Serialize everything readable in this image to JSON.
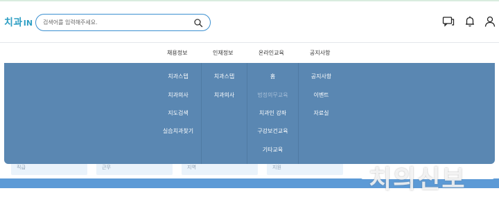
{
  "logo": {
    "korean": "치과",
    "in_prefix": "I",
    "in_suffix": "N"
  },
  "search": {
    "placeholder": "검색어를 입력해주세요."
  },
  "header_icons": [
    "chat-icon",
    "bell-icon",
    "user-icon"
  ],
  "nav": {
    "items": [
      "채용정보",
      "인재정보",
      "온라인교육",
      "공지사항"
    ]
  },
  "mega_menu": {
    "columns": [
      {
        "links": [
          "치과스텝",
          "치과의사",
          "지도검색",
          "실습치과찾기"
        ]
      },
      {
        "links": [
          "치과스텝",
          "치과의사"
        ]
      },
      {
        "links": [
          "홈",
          "법정의무교육",
          "치과인 강좌",
          "구강보건교육",
          "기타교육"
        ],
        "muted_index": 1
      },
      {
        "links": [
          "공지사항",
          "이벤트",
          "자료실"
        ]
      }
    ]
  },
  "background_cards": [
    "직급",
    "근무",
    "지역",
    "지원"
  ],
  "watermark": "치의신보",
  "colors": {
    "accent": "#3a8fd0",
    "mega_bg": "#5a87b2",
    "banner": "#5c9ad6",
    "logo_blue": "#2f9fc4",
    "logo_green": "#5ab43a"
  }
}
